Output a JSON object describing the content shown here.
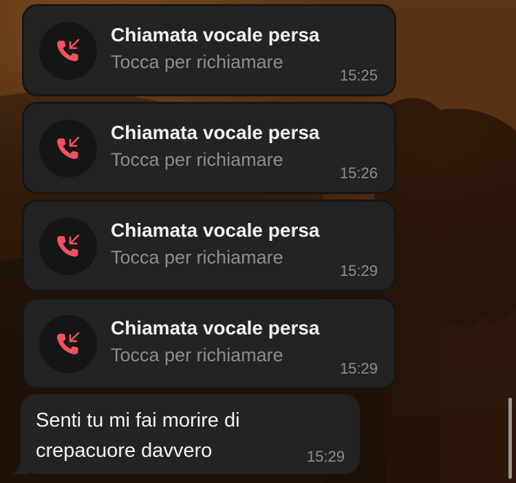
{
  "chat": {
    "calls": [
      {
        "title": "Chiamata vocale persa",
        "subtitle": "Tocca per richiamare",
        "time": "15:25"
      },
      {
        "title": "Chiamata vocale persa",
        "subtitle": "Tocca per richiamare",
        "time": "15:26"
      },
      {
        "title": "Chiamata vocale persa",
        "subtitle": "Tocca per richiamare",
        "time": "15:29"
      },
      {
        "title": "Chiamata vocale persa",
        "subtitle": "Tocca per richiamare",
        "time": "15:29"
      }
    ],
    "message": {
      "text": "Senti tu mi fai morire di crepacuore davvero",
      "time": "15:29"
    }
  },
  "icons": {
    "missed_call": "missed-call-icon"
  },
  "colors": {
    "bubble_bg": "#232323",
    "icon_circle_bg": "#161616",
    "missed_call_red": "#f0525f",
    "title_text": "#f2f2f2",
    "secondary_text": "#8d8d8d"
  }
}
